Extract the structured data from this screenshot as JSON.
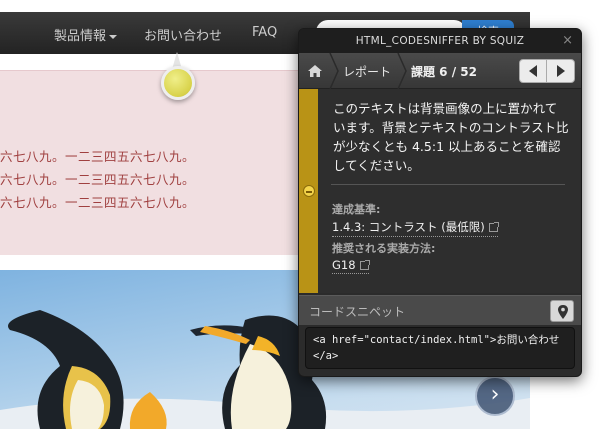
{
  "navbar": {
    "items": [
      "製品情報",
      "お問い合わせ",
      "FAQ"
    ],
    "search_button_label": "検索"
  },
  "content": {
    "lines": [
      "六七八九。一二三四五六七八九。",
      "六七八九。一二三四五六七八九。",
      "六七八九。一二三四五六七八九。"
    ]
  },
  "hero": {
    "next_label": "›"
  },
  "panel": {
    "title": "HTML_CODESNIFFER BY SQUIZ",
    "close_label": "×",
    "breadcrumb": {
      "report": "レポート",
      "issue": "課題 6 / 52"
    },
    "issue": {
      "message": "このテキストは背景画像の上に置かれています。背景とテキストのコントラスト比が少なくとも 4.5:1 以上あることを確認してください。",
      "criterion_heading": "達成基準:",
      "criterion_link": "1.4.3: コントラスト (最低限)",
      "technique_heading": "推奨される実装方法:",
      "technique_link": "G18"
    },
    "snippet": {
      "title": "コードスニペット",
      "code_line1": "<a href=\"contact/index.html\">お問い合わせ",
      "code_line2": "</a>"
    }
  },
  "colors": {
    "navbar": "#2a2a2a",
    "pink_band": "#f1dfe1",
    "pink_text": "#a04040",
    "warning_bar": "#b99316",
    "pin": "#d8d24a"
  }
}
